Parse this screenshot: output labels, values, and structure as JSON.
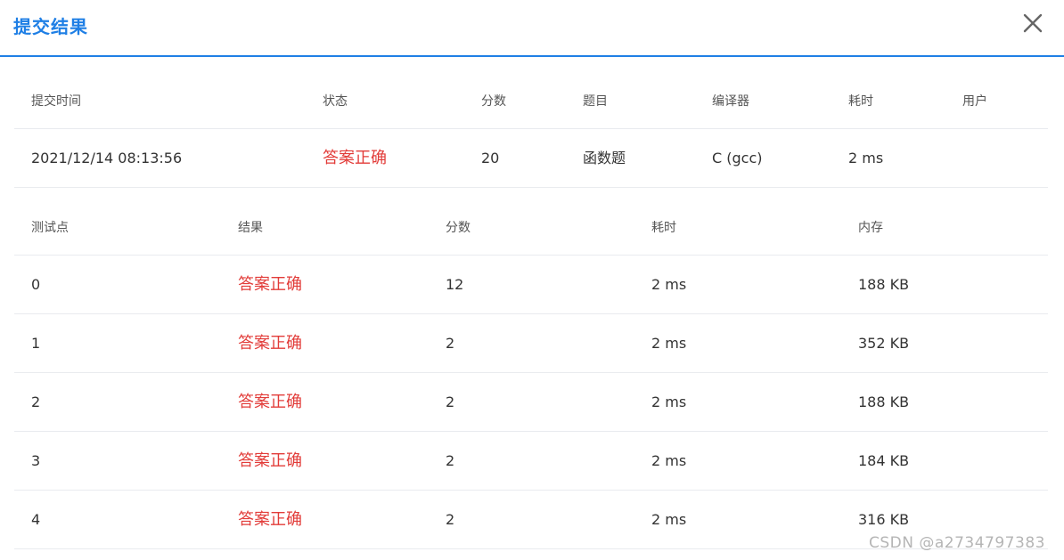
{
  "dialog": {
    "title": "提交结果"
  },
  "submission": {
    "headers": [
      "提交时间",
      "状态",
      "分数",
      "题目",
      "编译器",
      "耗时",
      "用户"
    ],
    "row": {
      "time": "2021/12/14 08:13:56",
      "status": "答案正确",
      "score": "20",
      "problem": "函数题",
      "compiler": "C (gcc)",
      "duration": "2 ms",
      "user": ""
    }
  },
  "testcases": {
    "headers": [
      "测试点",
      "结果",
      "分数",
      "耗时",
      "内存"
    ],
    "rows": [
      {
        "id": "0",
        "result": "答案正确",
        "score": "12",
        "time": "2 ms",
        "memory": "188 KB"
      },
      {
        "id": "1",
        "result": "答案正确",
        "score": "2",
        "time": "2 ms",
        "memory": "352 KB"
      },
      {
        "id": "2",
        "result": "答案正确",
        "score": "2",
        "time": "2 ms",
        "memory": "188 KB"
      },
      {
        "id": "3",
        "result": "答案正确",
        "score": "2",
        "time": "2 ms",
        "memory": "184 KB"
      },
      {
        "id": "4",
        "result": "答案正确",
        "score": "2",
        "time": "2 ms",
        "memory": "316 KB"
      }
    ]
  },
  "watermark": "CSDN @a2734797383",
  "colors": {
    "accent": "#1f7fe5",
    "accepted": "#e23c39"
  }
}
